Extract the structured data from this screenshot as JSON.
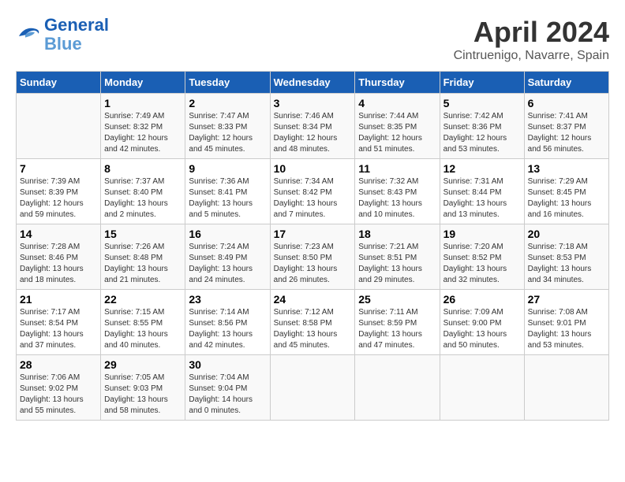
{
  "logo": {
    "line1": "General",
    "line2": "Blue"
  },
  "title": "April 2024",
  "subtitle": "Cintruenigo, Navarre, Spain",
  "headers": [
    "Sunday",
    "Monday",
    "Tuesday",
    "Wednesday",
    "Thursday",
    "Friday",
    "Saturday"
  ],
  "weeks": [
    [
      {
        "day": "",
        "info": ""
      },
      {
        "day": "1",
        "info": "Sunrise: 7:49 AM\nSunset: 8:32 PM\nDaylight: 12 hours\nand 42 minutes."
      },
      {
        "day": "2",
        "info": "Sunrise: 7:47 AM\nSunset: 8:33 PM\nDaylight: 12 hours\nand 45 minutes."
      },
      {
        "day": "3",
        "info": "Sunrise: 7:46 AM\nSunset: 8:34 PM\nDaylight: 12 hours\nand 48 minutes."
      },
      {
        "day": "4",
        "info": "Sunrise: 7:44 AM\nSunset: 8:35 PM\nDaylight: 12 hours\nand 51 minutes."
      },
      {
        "day": "5",
        "info": "Sunrise: 7:42 AM\nSunset: 8:36 PM\nDaylight: 12 hours\nand 53 minutes."
      },
      {
        "day": "6",
        "info": "Sunrise: 7:41 AM\nSunset: 8:37 PM\nDaylight: 12 hours\nand 56 minutes."
      }
    ],
    [
      {
        "day": "7",
        "info": "Sunrise: 7:39 AM\nSunset: 8:39 PM\nDaylight: 12 hours\nand 59 minutes."
      },
      {
        "day": "8",
        "info": "Sunrise: 7:37 AM\nSunset: 8:40 PM\nDaylight: 13 hours\nand 2 minutes."
      },
      {
        "day": "9",
        "info": "Sunrise: 7:36 AM\nSunset: 8:41 PM\nDaylight: 13 hours\nand 5 minutes."
      },
      {
        "day": "10",
        "info": "Sunrise: 7:34 AM\nSunset: 8:42 PM\nDaylight: 13 hours\nand 7 minutes."
      },
      {
        "day": "11",
        "info": "Sunrise: 7:32 AM\nSunset: 8:43 PM\nDaylight: 13 hours\nand 10 minutes."
      },
      {
        "day": "12",
        "info": "Sunrise: 7:31 AM\nSunset: 8:44 PM\nDaylight: 13 hours\nand 13 minutes."
      },
      {
        "day": "13",
        "info": "Sunrise: 7:29 AM\nSunset: 8:45 PM\nDaylight: 13 hours\nand 16 minutes."
      }
    ],
    [
      {
        "day": "14",
        "info": "Sunrise: 7:28 AM\nSunset: 8:46 PM\nDaylight: 13 hours\nand 18 minutes."
      },
      {
        "day": "15",
        "info": "Sunrise: 7:26 AM\nSunset: 8:48 PM\nDaylight: 13 hours\nand 21 minutes."
      },
      {
        "day": "16",
        "info": "Sunrise: 7:24 AM\nSunset: 8:49 PM\nDaylight: 13 hours\nand 24 minutes."
      },
      {
        "day": "17",
        "info": "Sunrise: 7:23 AM\nSunset: 8:50 PM\nDaylight: 13 hours\nand 26 minutes."
      },
      {
        "day": "18",
        "info": "Sunrise: 7:21 AM\nSunset: 8:51 PM\nDaylight: 13 hours\nand 29 minutes."
      },
      {
        "day": "19",
        "info": "Sunrise: 7:20 AM\nSunset: 8:52 PM\nDaylight: 13 hours\nand 32 minutes."
      },
      {
        "day": "20",
        "info": "Sunrise: 7:18 AM\nSunset: 8:53 PM\nDaylight: 13 hours\nand 34 minutes."
      }
    ],
    [
      {
        "day": "21",
        "info": "Sunrise: 7:17 AM\nSunset: 8:54 PM\nDaylight: 13 hours\nand 37 minutes."
      },
      {
        "day": "22",
        "info": "Sunrise: 7:15 AM\nSunset: 8:55 PM\nDaylight: 13 hours\nand 40 minutes."
      },
      {
        "day": "23",
        "info": "Sunrise: 7:14 AM\nSunset: 8:56 PM\nDaylight: 13 hours\nand 42 minutes."
      },
      {
        "day": "24",
        "info": "Sunrise: 7:12 AM\nSunset: 8:58 PM\nDaylight: 13 hours\nand 45 minutes."
      },
      {
        "day": "25",
        "info": "Sunrise: 7:11 AM\nSunset: 8:59 PM\nDaylight: 13 hours\nand 47 minutes."
      },
      {
        "day": "26",
        "info": "Sunrise: 7:09 AM\nSunset: 9:00 PM\nDaylight: 13 hours\nand 50 minutes."
      },
      {
        "day": "27",
        "info": "Sunrise: 7:08 AM\nSunset: 9:01 PM\nDaylight: 13 hours\nand 53 minutes."
      }
    ],
    [
      {
        "day": "28",
        "info": "Sunrise: 7:06 AM\nSunset: 9:02 PM\nDaylight: 13 hours\nand 55 minutes."
      },
      {
        "day": "29",
        "info": "Sunrise: 7:05 AM\nSunset: 9:03 PM\nDaylight: 13 hours\nand 58 minutes."
      },
      {
        "day": "30",
        "info": "Sunrise: 7:04 AM\nSunset: 9:04 PM\nDaylight: 14 hours\nand 0 minutes."
      },
      {
        "day": "",
        "info": ""
      },
      {
        "day": "",
        "info": ""
      },
      {
        "day": "",
        "info": ""
      },
      {
        "day": "",
        "info": ""
      }
    ]
  ]
}
